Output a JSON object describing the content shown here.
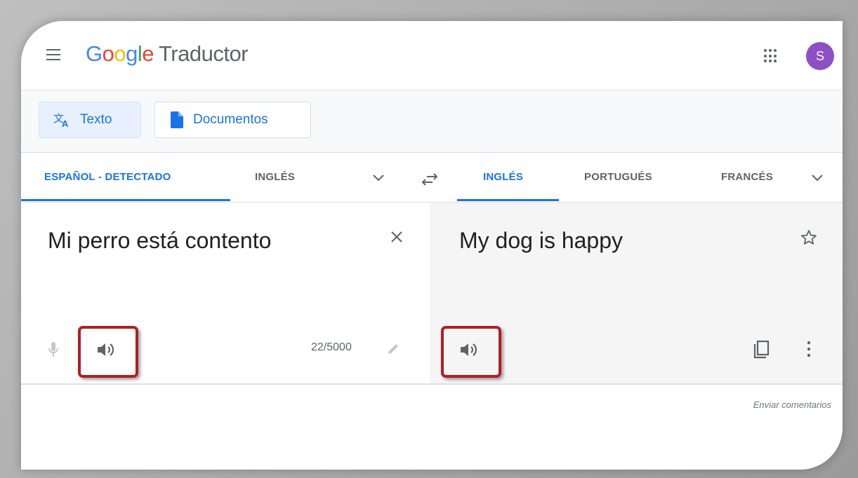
{
  "header": {
    "logo_letters": [
      "G",
      "o",
      "o",
      "g",
      "l",
      "e"
    ],
    "product_name": "Traductor",
    "avatar_initial": "S"
  },
  "modes": {
    "text_label": "Texto",
    "documents_label": "Documentos"
  },
  "source_languages": [
    "ESPAÑOL - DETECTADO",
    "INGLÉS"
  ],
  "target_languages": [
    "INGLÉS",
    "PORTUGUÉS",
    "FRANCÉS"
  ],
  "source": {
    "text": "Mi perro está contento",
    "char_count": "22/5000"
  },
  "target": {
    "text": "My dog is happy"
  },
  "footer": {
    "feedback": "Enviar comentarios"
  },
  "colors": {
    "accent": "#1a73e8",
    "highlight_border": "#b01f24",
    "avatar_bg": "#8e4fc6"
  }
}
